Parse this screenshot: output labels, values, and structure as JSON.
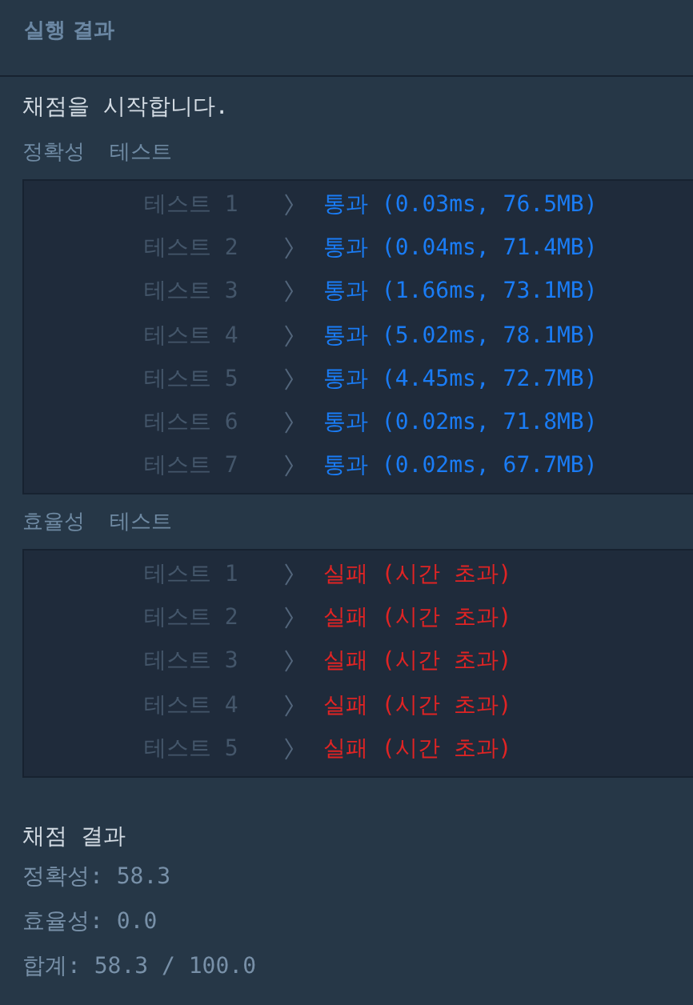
{
  "header": {
    "title": "실행 결과"
  },
  "intro": "채점을 시작합니다.",
  "sections": [
    {
      "title": "정확성  테스트",
      "tests": [
        {
          "label": "테스트 1",
          "kind": "pass",
          "result": "통과 (0.03ms, 76.5MB)"
        },
        {
          "label": "테스트 2",
          "kind": "pass",
          "result": "통과 (0.04ms, 71.4MB)"
        },
        {
          "label": "테스트 3",
          "kind": "pass",
          "result": "통과 (1.66ms, 73.1MB)"
        },
        {
          "label": "테스트 4",
          "kind": "pass",
          "result": "통과 (5.02ms, 78.1MB)"
        },
        {
          "label": "테스트 5",
          "kind": "pass",
          "result": "통과 (4.45ms, 72.7MB)"
        },
        {
          "label": "테스트 6",
          "kind": "pass",
          "result": "통과 (0.02ms, 71.8MB)"
        },
        {
          "label": "테스트 7",
          "kind": "pass",
          "result": "통과 (0.02ms, 67.7MB)"
        }
      ]
    },
    {
      "title": "효율성  테스트",
      "tests": [
        {
          "label": "테스트 1",
          "kind": "fail",
          "result": "실패 (시간 초과)"
        },
        {
          "label": "테스트 2",
          "kind": "fail",
          "result": "실패 (시간 초과)"
        },
        {
          "label": "테스트 3",
          "kind": "fail",
          "result": "실패 (시간 초과)"
        },
        {
          "label": "테스트 4",
          "kind": "fail",
          "result": "실패 (시간 초과)"
        },
        {
          "label": "테스트 5",
          "kind": "fail",
          "result": "실패 (시간 초과)"
        }
      ]
    }
  ],
  "summary": {
    "title": "채점 결과",
    "lines": [
      "정확성: 58.3",
      "효율성: 0.0",
      "합계: 58.3 / 100.0"
    ]
  }
}
